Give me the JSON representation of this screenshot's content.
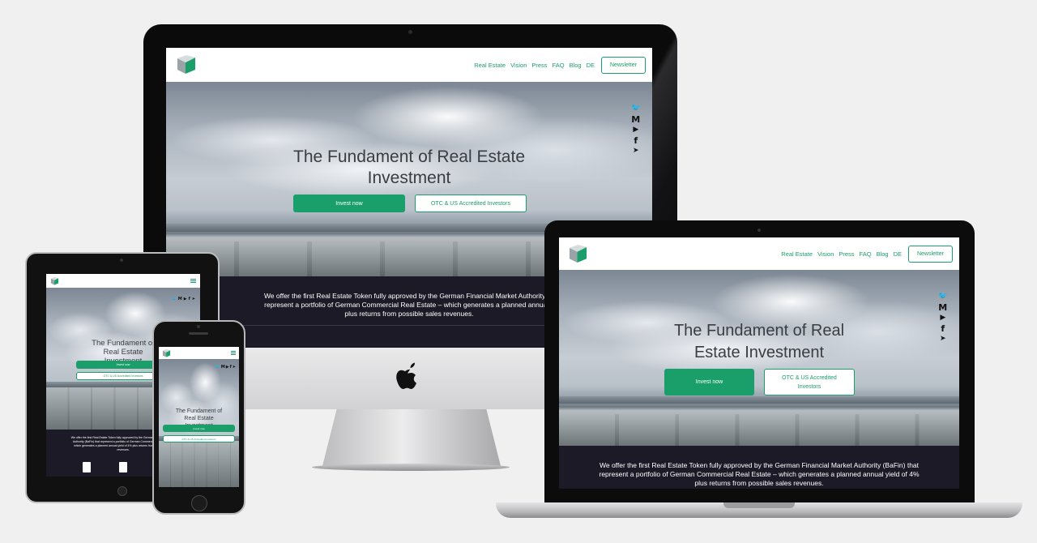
{
  "site": {
    "nav": [
      "Real Estate",
      "Vision",
      "Press",
      "FAQ",
      "Blog",
      "DE"
    ],
    "newsletter": "Newsletter",
    "hero_title": "The Fundament of Real Estate Investment",
    "hero_title_laptop_line1": "The Fundament of Real",
    "hero_title_laptop_line2": "Estate Investment",
    "hero_title_desktop_line1": "The Fundament of Real Estate",
    "hero_title_desktop_line2": "Investment",
    "invest_button": "Invest now",
    "otc_button": "OTC & US Accredited Investors",
    "intro_text": "We offer the first Real Estate Token fully approved by the German Financial Market Authority (BaFin) that represent a portfolio of German Commercial Real Estate – which generates a planned annual yield of 4% plus returns from possible sales revenues.",
    "intro_imac_l1": "We offer the first Real Estate Token fully approved by the German Financial Market Authority (B",
    "intro_imac_l2": "represent a portfolio of German Commercial Real Estate – which generates a planned annual y",
    "intro_imac_l3": "plus returns from possible sales revenues.",
    "intro_laptop_l1": "We offer the first Real Estate Token fully approved by the German Financial Market Authority (BaFin) that",
    "intro_laptop_l2": "represent a portfolio of German Commercial Real Estate – which generates a planned annual yield of 4%",
    "intro_laptop_l3": "plus returns from possible sales revenues."
  },
  "social_icons": [
    "twitter-icon",
    "medium-icon",
    "youtube-icon",
    "facebook-icon",
    "telegram-icon"
  ],
  "social_glyphs": {
    "twitter": "🐦",
    "medium": "M",
    "youtube": "▶",
    "facebook": "f",
    "telegram": "➤"
  },
  "devices": [
    "desktop",
    "laptop",
    "tablet",
    "phone"
  ],
  "colors": {
    "brand_green": "#1a9e6a",
    "dark_band": "#1b1a26",
    "background": "#f0f0f0"
  }
}
